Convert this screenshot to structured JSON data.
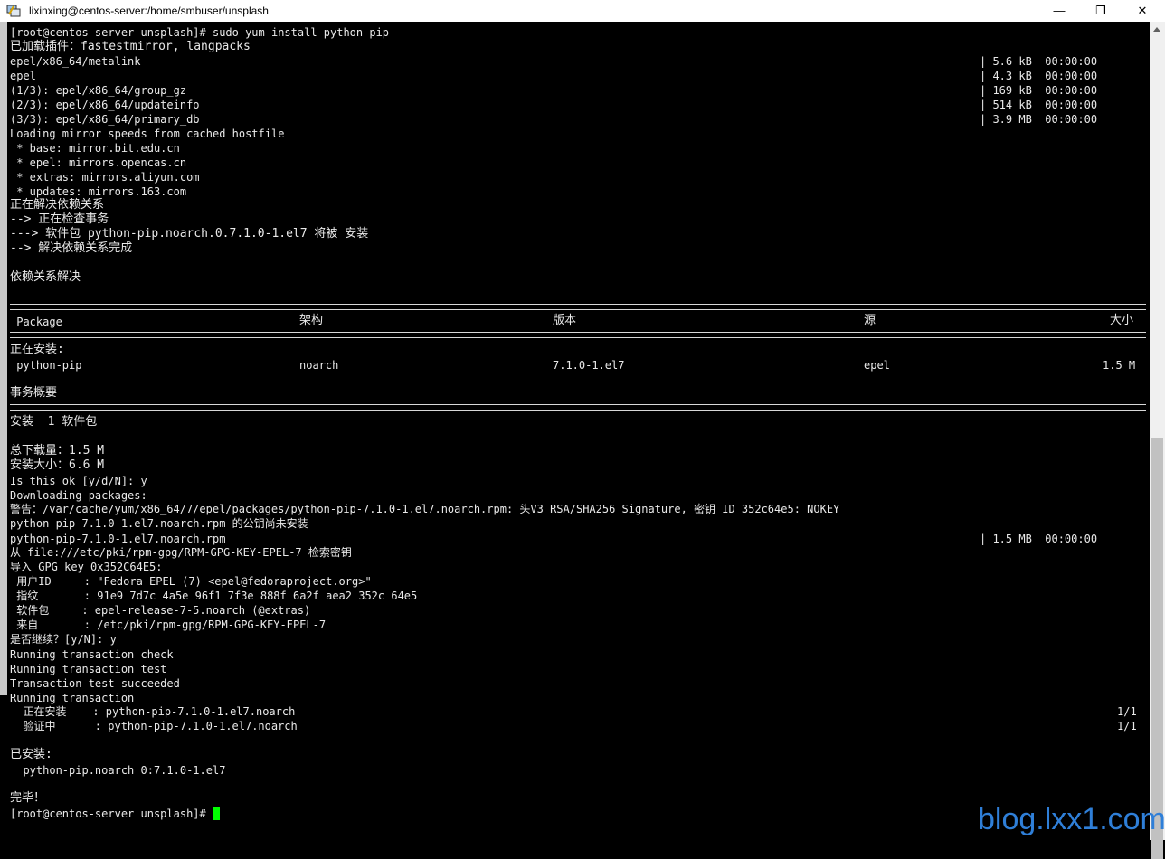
{
  "window": {
    "title": "lixinxing@centos-server:/home/smbuser/unsplash",
    "minimize": "—",
    "maximize": "❐",
    "close": "✕"
  },
  "terminal": {
    "lines": [
      "[root@centos-server unsplash]# sudo yum install python-pip",
      "已加载插件：fastestmirror, langpacks",
      "epel/x86_64/metalink",
      "epel",
      "(1/3): epel/x86_64/group_gz",
      "(2/3): epel/x86_64/updateinfo",
      "(3/3): epel/x86_64/primary_db",
      "Loading mirror speeds from cached hostfile",
      " * base: mirror.bit.edu.cn",
      " * epel: mirrors.opencas.cn",
      " * extras: mirrors.aliyun.com",
      " * updates: mirrors.163.com",
      "正在解决依赖关系",
      "--> 正在检查事务",
      "---> 软件包 python-pip.noarch.0.7.1.0-1.el7 将被 安装",
      "--> 解决依赖关系完成",
      "依赖关系解决",
      " Package",
      "架构",
      "版本",
      "源",
      "大小",
      "正在安装:",
      " python-pip",
      "noarch",
      "7.1.0-1.el7",
      "epel",
      "1.5 M",
      "事务概要",
      "安装  1 软件包",
      "总下载量：1.5 M",
      "安装大小：6.6 M",
      "Is this ok [y/d/N]: y",
      "Downloading packages:",
      "警告：/var/cache/yum/x86_64/7/epel/packages/python-pip-7.1.0-1.el7.noarch.rpm: 头V3 RSA/SHA256 Signature, 密钥 ID 352c64e5: NOKEY",
      "python-pip-7.1.0-1.el7.noarch.rpm 的公钥尚未安装",
      "python-pip-7.1.0-1.el7.noarch.rpm",
      "从 file:///etc/pki/rpm-gpg/RPM-GPG-KEY-EPEL-7 检索密钥",
      "导入 GPG key 0x352C64E5:",
      " 用户ID     : \"Fedora EPEL (7) <epel@fedoraproject.org>\"",
      " 指纹       : 91e9 7d7c 4a5e 96f1 7f3e 888f 6a2f aea2 352c 64e5",
      " 软件包     : epel-release-7-5.noarch (@extras)",
      " 来自       : /etc/pki/rpm-gpg/RPM-GPG-KEY-EPEL-7",
      "是否继续？[y/N]: y",
      "Running transaction check",
      "Running transaction test",
      "Transaction test succeeded",
      "Running transaction",
      "  正在安装    : python-pip-7.1.0-1.el7.noarch",
      "  验证中      : python-pip-7.1.0-1.el7.noarch",
      "已安装:",
      "  python-pip.noarch 0:7.1.0-1.el7",
      "完毕！",
      "[root@centos-server unsplash]# "
    ],
    "right": [
      "| 5.6 kB  00:00:00",
      "| 4.3 kB  00:00:00",
      "| 169 kB  00:00:00",
      "| 514 kB  00:00:00",
      "| 3.9 MB  00:00:00",
      "| 1.5 MB  00:00:00",
      "1/1",
      "1/1"
    ]
  },
  "watermark": "blog.lxx1.com",
  "colors": {
    "background": "#000000",
    "text": "#e9e9e9",
    "cursor": "#00ff00",
    "watermark": "#2f7fd8"
  }
}
